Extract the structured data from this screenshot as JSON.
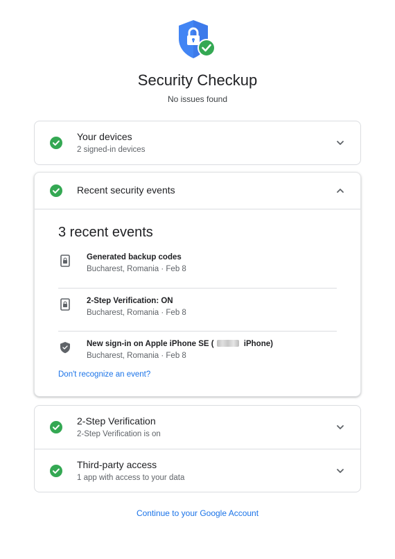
{
  "header": {
    "title": "Security Checkup",
    "subtitle": "No issues found"
  },
  "colors": {
    "shield": "#4285f4",
    "ok_green": "#34a853",
    "link": "#1a73e8"
  },
  "sections": {
    "devices": {
      "title": "Your devices",
      "subtitle": "2 signed-in devices",
      "icon": "check-circle-icon",
      "expanded": false
    },
    "recent_events": {
      "title": "Recent security events",
      "icon": "check-circle-icon",
      "expanded": true,
      "heading": "3 recent events",
      "events": [
        {
          "title": "Generated backup codes",
          "subtitle": "Bucharest, Romania · Feb 8",
          "icon": "device-lock-icon"
        },
        {
          "title": "2-Step Verification: ON",
          "subtitle": "Bucharest, Romania · Feb 8",
          "icon": "device-lock-icon"
        },
        {
          "title_before": "New sign-in on Apple iPhone SE (",
          "title_after": " iPhone)",
          "subtitle": "Bucharest, Romania · Feb 8",
          "icon": "shield-icon"
        }
      ],
      "link": "Don't recognize an event?"
    },
    "two_step": {
      "title": "2-Step Verification",
      "subtitle": "2-Step Verification is on",
      "icon": "check-circle-icon",
      "expanded": false
    },
    "third_party": {
      "title": "Third-party access",
      "subtitle": "1 app with access to your data",
      "icon": "check-circle-icon",
      "expanded": false
    }
  },
  "footer": {
    "continue_link": "Continue to your Google Account"
  }
}
